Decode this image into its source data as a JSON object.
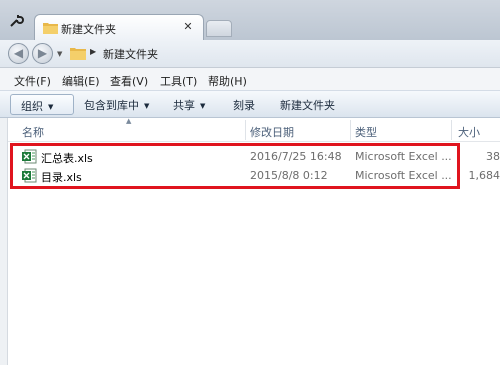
{
  "window": {
    "tab_title": "新建文件夹"
  },
  "address": {
    "path": "新建文件夹"
  },
  "menu": [
    {
      "label": "文件(F)"
    },
    {
      "label": "编辑(E)"
    },
    {
      "label": "查看(V)"
    },
    {
      "label": "工具(T)"
    },
    {
      "label": "帮助(H)"
    }
  ],
  "toolbar": {
    "organize": "组织",
    "include_library": "包含到库中",
    "share": "共享",
    "burn": "刻录",
    "new_folder": "新建文件夹"
  },
  "columns": {
    "name": "名称",
    "modified": "修改日期",
    "type": "类型",
    "size": "大小"
  },
  "files": [
    {
      "name": "汇总表.xls",
      "modified": "2016/7/25 16:48",
      "type": "Microsoft Excel ...",
      "size": "38"
    },
    {
      "name": "目录.xls",
      "modified": "2015/8/8 0:12",
      "type": "Microsoft Excel ...",
      "size": "1,684"
    }
  ],
  "colors": {
    "highlight": "#e0141e",
    "excel_green": "#1d7a3a"
  }
}
